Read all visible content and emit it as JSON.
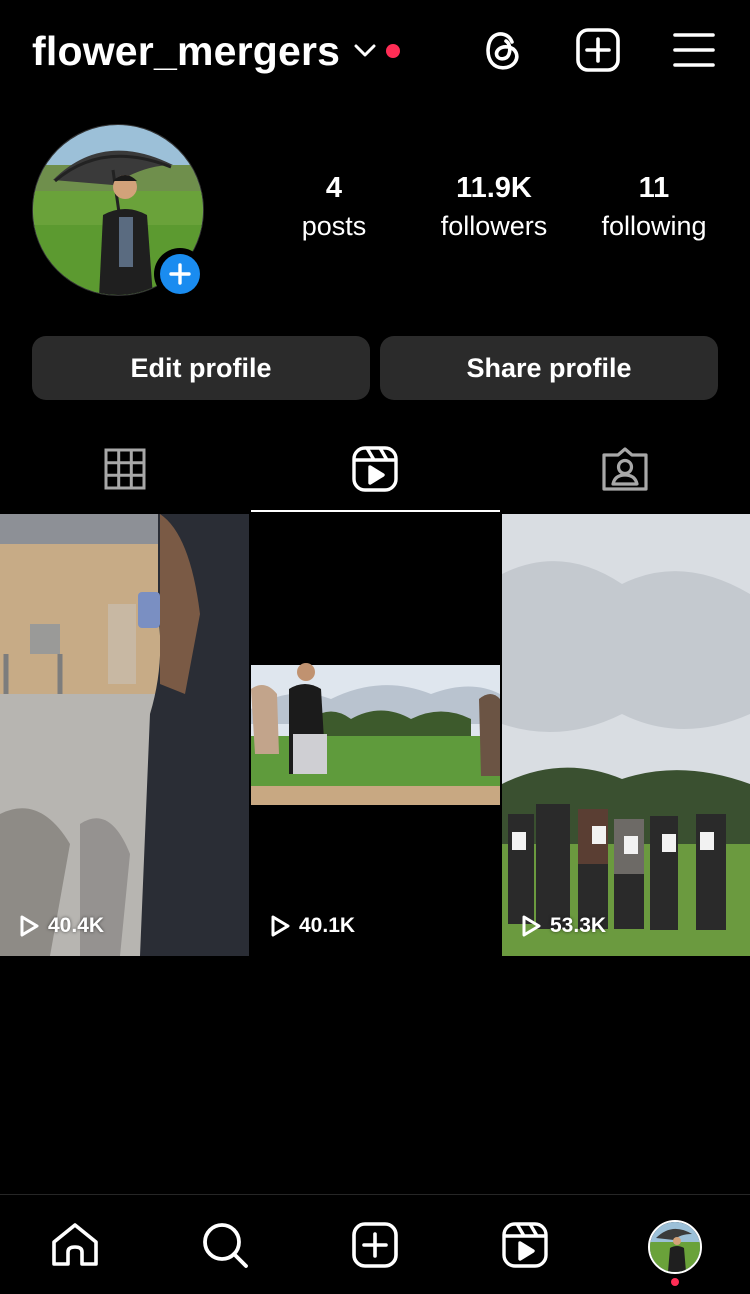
{
  "header": {
    "username": "flower_mergers",
    "icons": [
      "threads-icon",
      "create-icon",
      "menu-icon"
    ]
  },
  "profile": {
    "stats": [
      {
        "value": "4",
        "label": "posts"
      },
      {
        "value": "11.9K",
        "label": "followers"
      },
      {
        "value": "11",
        "label": "following"
      }
    ],
    "edit_label": "Edit profile",
    "share_label": "Share profile"
  },
  "tabs": [
    {
      "icon": "grid-icon",
      "active": false
    },
    {
      "icon": "reels-icon",
      "active": true
    },
    {
      "icon": "tagged-icon",
      "active": false
    }
  ],
  "reels": [
    {
      "views": "40.4K"
    },
    {
      "views": "40.1K"
    },
    {
      "views": "53.3K"
    }
  ],
  "bottom_nav": [
    "home-icon",
    "search-icon",
    "create-icon",
    "reels-icon",
    "profile-avatar"
  ],
  "colors": {
    "accent_blue": "#1a8cf0",
    "notification_red": "#ff2d55",
    "button_bg": "#2b2b2b"
  }
}
